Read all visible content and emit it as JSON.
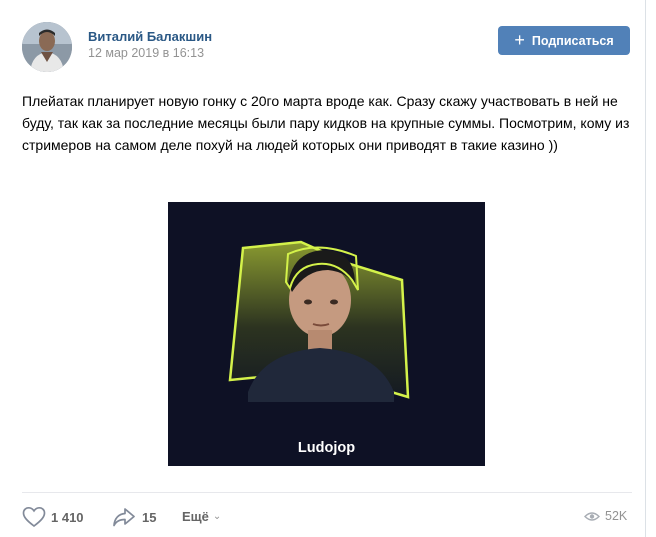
{
  "post": {
    "author": {
      "name": "Виталий Балакшин",
      "date": "12 мар 2019 в 16:13"
    },
    "subscribe_label": "Подписаться",
    "text": "Плейатак планирует новую гонку с 20го марта вроде как. Сразу скажу участвовать в ней не буду, так как за последние месяцы были пару кидков на крупные суммы. Посмотрим, кому из стримеров на самом деле похуй на людей которых они приводят в такие казино ))",
    "image": {
      "caption": "Ludojop"
    },
    "stats": {
      "likes": "1 410",
      "shares": "15",
      "more_label": "Ещё",
      "views": "52K"
    }
  },
  "colors": {
    "link": "#2a5885",
    "button": "#5181b8",
    "muted": "#939393",
    "image_bg": "#0e1125",
    "accent": "#d4f24a"
  },
  "icons": [
    "plus-icon",
    "heart-icon",
    "share-icon",
    "chevron-down-icon",
    "eye-icon"
  ]
}
